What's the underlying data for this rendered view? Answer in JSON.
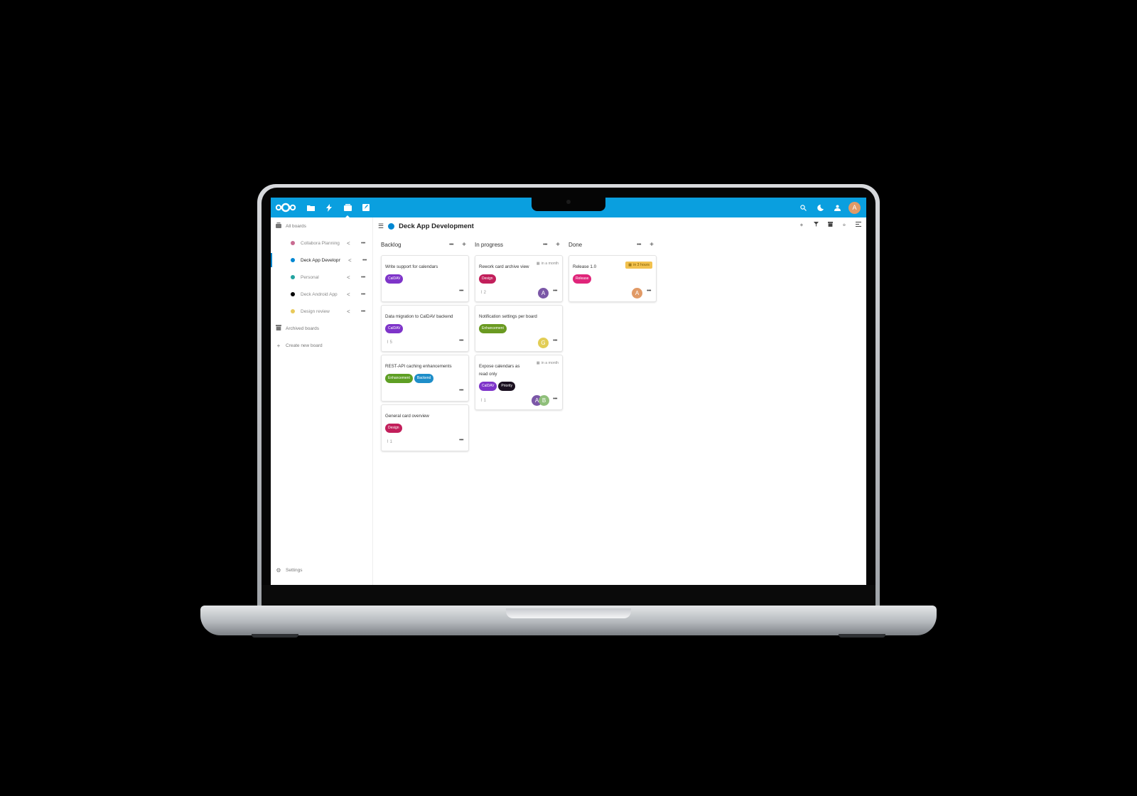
{
  "colors": {
    "header": "#0a9fdf",
    "accent": "#0082c9"
  },
  "header": {
    "apps": [
      {
        "name": "files-icon",
        "glyph": "▬"
      },
      {
        "name": "activity-icon",
        "glyph": "⚡"
      },
      {
        "name": "deck-icon",
        "glyph": "▤"
      },
      {
        "name": "notes-icon",
        "glyph": "✎"
      }
    ],
    "right_icons": [
      {
        "name": "search-icon",
        "glyph": "⌕"
      },
      {
        "name": "status-icon",
        "glyph": "◐"
      },
      {
        "name": "contacts-icon",
        "glyph": "♟"
      }
    ],
    "user_initial": "A"
  },
  "sidebar": {
    "all_boards": "All boards",
    "boards": [
      {
        "label": "Collabora Planning",
        "color": "#c96b91"
      },
      {
        "label": "Deck App Development",
        "color": "#0087d2",
        "active": true
      },
      {
        "label": "Personal",
        "color": "#22a39f"
      },
      {
        "label": "Deck Android App",
        "color": "#000000"
      },
      {
        "label": "Design review",
        "color": "#e8c95a"
      }
    ],
    "archived": "Archived boards",
    "create": "Create new board",
    "settings": "Settings"
  },
  "board": {
    "title": "Deck App Development",
    "stacks": [
      {
        "title": "Backlog",
        "cards": [
          {
            "title": "Write support for calendars",
            "labels": [
              {
                "text": "CalDAV",
                "color": "#7e34c9"
              }
            ]
          },
          {
            "title": "Data migration to CalDAV backend",
            "labels": [
              {
                "text": "CalDAV",
                "color": "#7e34c9"
              }
            ],
            "attachments": "5"
          },
          {
            "title": "REST-API caching enhancements",
            "labels": [
              {
                "text": "Enhancement",
                "color": "#5e9f24"
              },
              {
                "text": "Backend",
                "color": "#1e8ec9"
              }
            ]
          },
          {
            "title": "General card overview",
            "labels": [
              {
                "text": "Design",
                "color": "#c21f5b"
              }
            ],
            "attachments": "1"
          }
        ]
      },
      {
        "title": "In progress",
        "cards": [
          {
            "title": "Rework card archive view",
            "due": "in a month",
            "labels": [
              {
                "text": "Design",
                "color": "#c21f5b"
              }
            ],
            "attachments": "2",
            "avatars": [
              {
                "initial": "A",
                "color": "#7b57a7"
              }
            ]
          },
          {
            "title": "Notification settings per board",
            "labels": [
              {
                "text": "Enhancement",
                "color": "#6a9a21"
              }
            ],
            "avatars": [
              {
                "initial": "G",
                "color": "#e2cd55"
              }
            ]
          },
          {
            "title_line1": "Expose calendars as",
            "title_line2": "read only",
            "due": "in a month",
            "labels": [
              {
                "text": "CalDAV",
                "color": "#7e34c9"
              },
              {
                "text": "Priority",
                "color": "#1a1020"
              }
            ],
            "attachments": "1",
            "avatars": [
              {
                "initial": "A",
                "color": "#7b57a7"
              },
              {
                "initial": "B",
                "color": "#8fbf7a"
              }
            ]
          }
        ]
      },
      {
        "title": "Done",
        "cards": [
          {
            "title": "Release 1.0",
            "due": "in 3 hours",
            "labels": [
              {
                "text": "Release",
                "color": "#e0257a"
              }
            ],
            "avatars": [
              {
                "initial": "A",
                "color": "#e19a66"
              }
            ]
          }
        ]
      }
    ]
  },
  "more": "•••",
  "add": "+"
}
